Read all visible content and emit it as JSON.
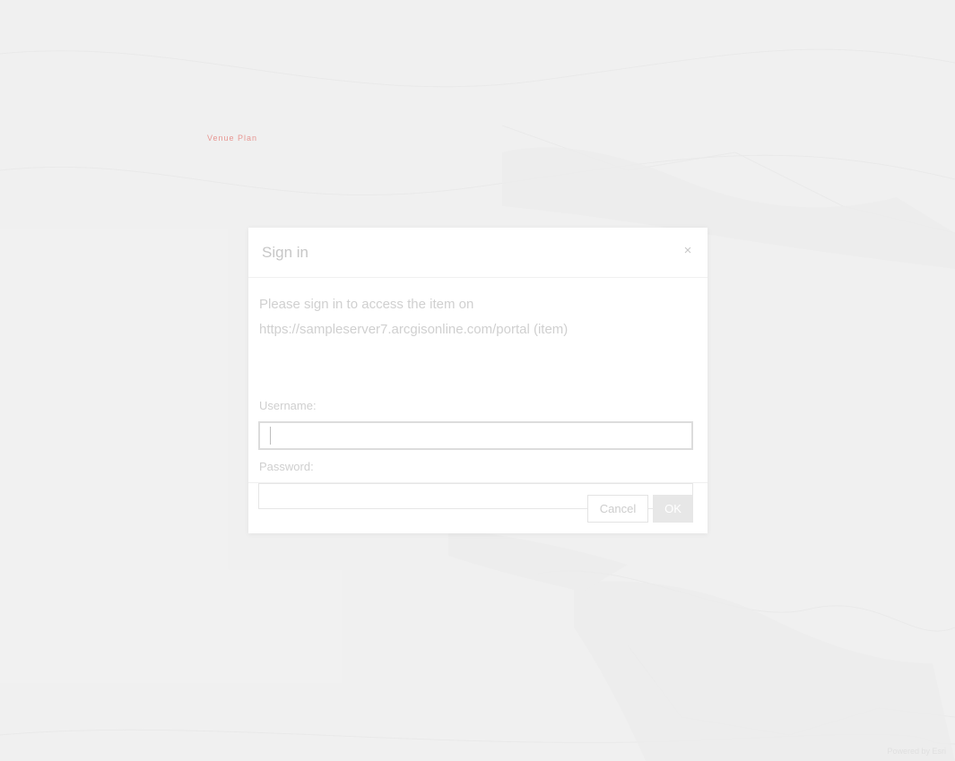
{
  "map": {
    "marker_label": "Venue Plan",
    "attribution": "Powered by Esri"
  },
  "dialog": {
    "title": "Sign in",
    "close_glyph": "×",
    "message_line1": "Please sign in to access the item on",
    "message_line2": "https://sampleserver7.arcgisonline.com/portal (item)",
    "username_label": "Username:",
    "username_value": "",
    "password_label": "Password:",
    "password_value": "",
    "cancel_label": "Cancel",
    "ok_label": "OK"
  },
  "colors": {
    "backdrop": "#ebebeb",
    "dialog_bg": "#ffffff",
    "marker": "#d9473f"
  }
}
